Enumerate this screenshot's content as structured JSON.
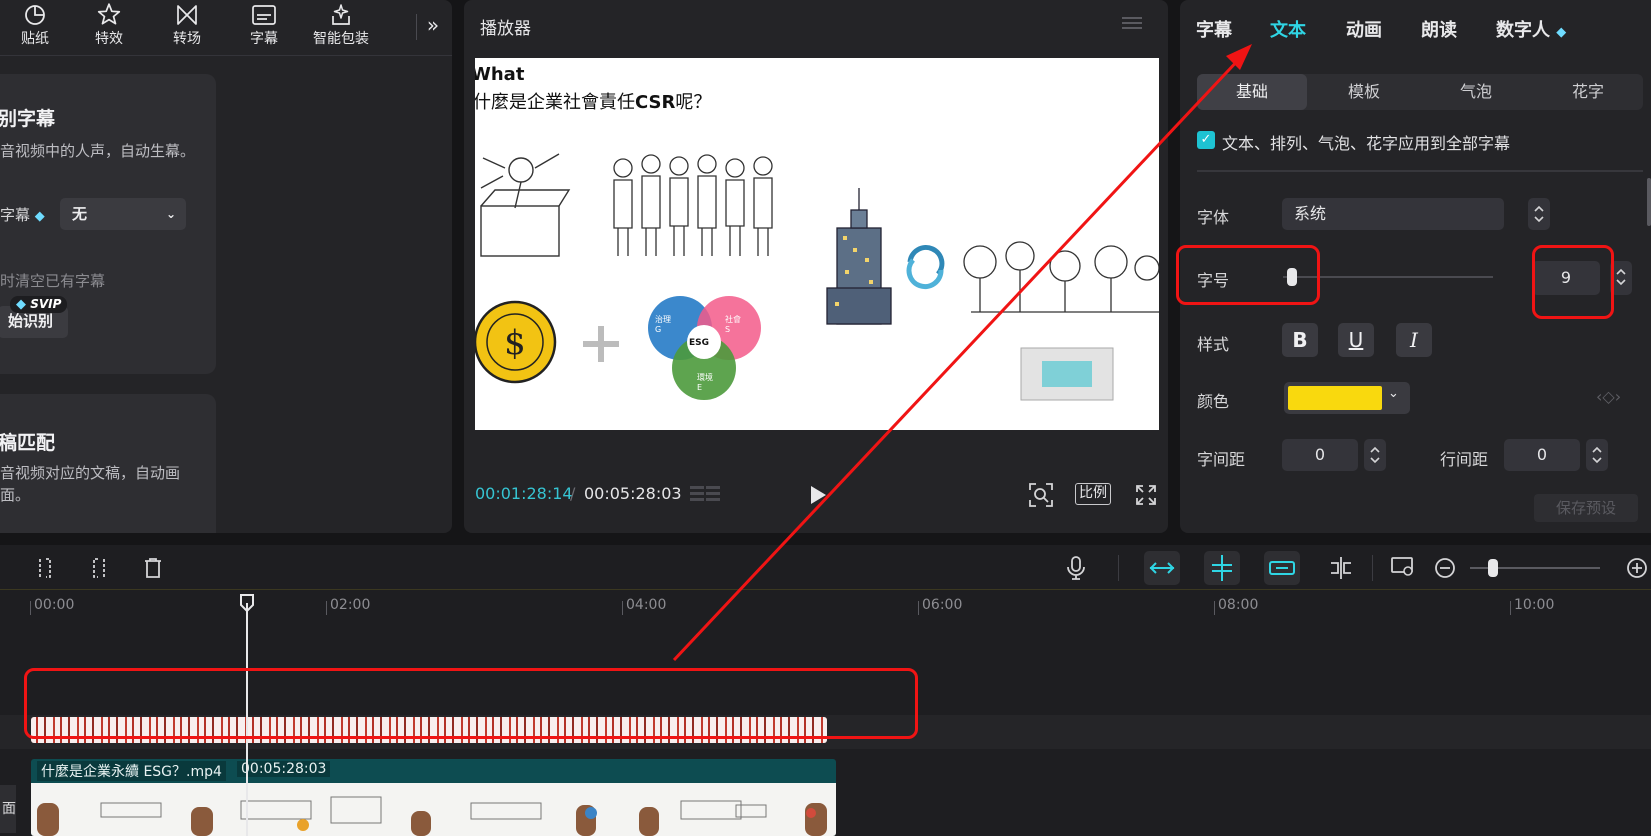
{
  "left_toolbar": {
    "items": [
      {
        "label": "贴纸",
        "icon": "sticker-icon"
      },
      {
        "label": "特效",
        "icon": "effects-icon"
      },
      {
        "label": "转场",
        "icon": "transition-icon"
      },
      {
        "label": "字幕",
        "icon": "subtitle-icon"
      },
      {
        "label": "智能包装",
        "icon": "smart-pack-icon"
      }
    ],
    "expand_icon": "»"
  },
  "auto_card": {
    "title": "别字幕",
    "desc": "音视频中的人声，自动生幕。",
    "bilingual_label": "字幕",
    "bilingual_value": "无",
    "clear_label": "时清空已有字幕",
    "svip": "SVIP",
    "start_button": "始识别"
  },
  "match_card": {
    "title": "稿匹配",
    "desc": "音视频对应的文稿，自动画面。"
  },
  "player": {
    "title": "播放器",
    "time_current": "00:01:28:14",
    "time_sep": "/",
    "time_total": "00:05:28:03",
    "ratio_label": "比例"
  },
  "video_frame": {
    "heading": "What",
    "question_prefix": "什麼是企業社會責任",
    "question_bold": "CSR",
    "question_suffix": "呢？",
    "esg_center": "ESG",
    "esg_g": "治理 G",
    "esg_s": "社會 S",
    "esg_e": "環境 E"
  },
  "right_panel": {
    "tabs": [
      "字幕",
      "文本",
      "动画",
      "朗读",
      "数字人"
    ],
    "active_tab": "文本",
    "subtabs": [
      "基础",
      "模板",
      "气泡",
      "花字"
    ],
    "apply_all_text": "文本、排列、气泡、花字应用到全部字幕",
    "font_label": "字体",
    "font_value": "系统",
    "size_label": "字号",
    "size_value": "9",
    "size_level_fraction": 0.02,
    "style_label": "样式",
    "style_bold": "B",
    "style_underline": "U",
    "style_italic": "I",
    "color_label": "颜色",
    "color_value": "#f9d90e",
    "char_spacing_label": "字间距",
    "char_spacing_value": "0",
    "line_spacing_label": "行间距",
    "line_spacing_value": "0",
    "save_preset": "保存预设",
    "keyframe_icon": "‹◇›"
  },
  "timeline": {
    "ticks": [
      "00:00",
      "02:00",
      "04:00",
      "06:00",
      "08:00",
      "10:00"
    ],
    "video_clip_name": "什麼是企業永續 ESG？.mp4",
    "video_clip_duration": "00:05:28:03",
    "cover_label": "面"
  },
  "colors": {
    "accent": "#2fd5e4",
    "annotation_red": "#f01414",
    "subtitle_clip": "#a83026",
    "video_clip": "#0d4c51"
  }
}
